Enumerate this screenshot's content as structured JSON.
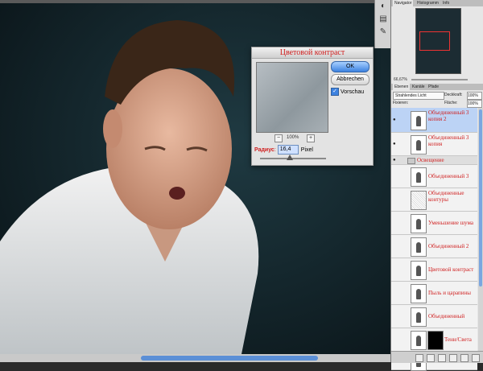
{
  "dialog": {
    "title": "Цветовой контраст",
    "ok_label": "OK",
    "cancel_label": "Abbrechen",
    "preview_label": "Vorschau",
    "preview_checked": true,
    "zoom_value": "100%",
    "zoom_out_symbol": "−",
    "zoom_in_symbol": "+",
    "radius_label": "Радиус",
    "radius_value": "16,4",
    "radius_unit": "Pixel",
    "radius_slider_fraction": 0.45
  },
  "tools": [
    {
      "icon": "eyedropper-icon",
      "glyph": "◐"
    },
    {
      "icon": "layers-icon",
      "glyph": "▤"
    },
    {
      "icon": "brush-icon",
      "glyph": "✎"
    }
  ],
  "panel": {
    "top_tabs": [
      "Navigator",
      "Histogramm",
      "Info"
    ],
    "mid_tabs": [
      "Ebenen",
      "Kanäle",
      "Pfade"
    ],
    "zoom": "66,67%",
    "blend_mode": "Strahlendes Licht",
    "opacity_label": "Deckkraft:",
    "opacity_value": "100%",
    "lock_label": "Fixieren:",
    "fill_label": "Fläche:",
    "fill_value": "100%",
    "group_name": "Освещение",
    "layers": [
      {
        "name": "Объединенный 3 копия 2",
        "visible": true,
        "selected": true,
        "thumb": "dark"
      },
      {
        "name": "Объединенный 3 копия",
        "visible": true,
        "selected": false,
        "thumb": "dark"
      },
      {
        "name": "Объединенный 3",
        "visible": false,
        "selected": false,
        "thumb": "dark"
      },
      {
        "name": "Объединенные контуры",
        "visible": false,
        "selected": false,
        "thumb": "noise"
      },
      {
        "name": "Уменьшение шума",
        "visible": false,
        "selected": false,
        "thumb": "dark"
      },
      {
        "name": "Объединенный 2",
        "visible": false,
        "selected": false,
        "thumb": "dark"
      },
      {
        "name": "Цветовой контраст",
        "visible": false,
        "selected": false,
        "thumb": "dark"
      },
      {
        "name": "Пыль и царапины",
        "visible": false,
        "selected": false,
        "thumb": "dark"
      },
      {
        "name": "Объединенный",
        "visible": false,
        "selected": false,
        "thumb": "dark"
      },
      {
        "name": "Тени/Света",
        "visible": false,
        "selected": false,
        "thumb": "dark",
        "mask": true
      },
      {
        "name": "Мальчик",
        "visible": true,
        "selected": false,
        "thumb": "dark"
      }
    ]
  },
  "colors": {
    "accent": "#3d82e0",
    "label_red": "#d02020",
    "canvas_bg": "#14232a"
  }
}
